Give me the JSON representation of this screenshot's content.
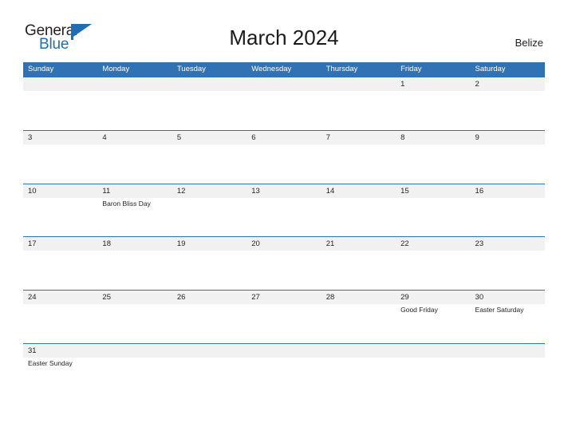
{
  "brand": {
    "name_part1": "General",
    "name_part2": "Blue",
    "flag_icon": "blue-triangle-flag",
    "colors": {
      "dark_text": "#231f20",
      "blue": "#1f6db5"
    }
  },
  "header": {
    "title": "March 2024",
    "region": "Belize"
  },
  "theme": {
    "header_blue": "#3172b5",
    "band_gray": "#f1f1f1",
    "rule_blue": "#3172b5",
    "text": "#231f20",
    "header_text": "#ffffff"
  },
  "calendar": {
    "month": "March",
    "year": "2024",
    "weekday_headers": [
      "Sunday",
      "Monday",
      "Tuesday",
      "Wednesday",
      "Thursday",
      "Friday",
      "Saturday"
    ],
    "weeks": [
      {
        "days": [
          {
            "number": "",
            "event": ""
          },
          {
            "number": "",
            "event": ""
          },
          {
            "number": "",
            "event": ""
          },
          {
            "number": "",
            "event": ""
          },
          {
            "number": "",
            "event": ""
          },
          {
            "number": "1",
            "event": ""
          },
          {
            "number": "2",
            "event": ""
          }
        ]
      },
      {
        "days": [
          {
            "number": "3",
            "event": ""
          },
          {
            "number": "4",
            "event": ""
          },
          {
            "number": "5",
            "event": ""
          },
          {
            "number": "6",
            "event": ""
          },
          {
            "number": "7",
            "event": ""
          },
          {
            "number": "8",
            "event": ""
          },
          {
            "number": "9",
            "event": ""
          }
        ]
      },
      {
        "days": [
          {
            "number": "10",
            "event": ""
          },
          {
            "number": "11",
            "event": "Baron Bliss Day"
          },
          {
            "number": "12",
            "event": ""
          },
          {
            "number": "13",
            "event": ""
          },
          {
            "number": "14",
            "event": ""
          },
          {
            "number": "15",
            "event": ""
          },
          {
            "number": "16",
            "event": ""
          }
        ]
      },
      {
        "days": [
          {
            "number": "17",
            "event": ""
          },
          {
            "number": "18",
            "event": ""
          },
          {
            "number": "19",
            "event": ""
          },
          {
            "number": "20",
            "event": ""
          },
          {
            "number": "21",
            "event": ""
          },
          {
            "number": "22",
            "event": ""
          },
          {
            "number": "23",
            "event": ""
          }
        ]
      },
      {
        "days": [
          {
            "number": "24",
            "event": ""
          },
          {
            "number": "25",
            "event": ""
          },
          {
            "number": "26",
            "event": ""
          },
          {
            "number": "27",
            "event": ""
          },
          {
            "number": "28",
            "event": ""
          },
          {
            "number": "29",
            "event": "Good Friday"
          },
          {
            "number": "30",
            "event": "Easter Saturday"
          }
        ]
      },
      {
        "days": [
          {
            "number": "31",
            "event": "Easter Sunday"
          },
          {
            "number": "",
            "event": ""
          },
          {
            "number": "",
            "event": ""
          },
          {
            "number": "",
            "event": ""
          },
          {
            "number": "",
            "event": ""
          },
          {
            "number": "",
            "event": ""
          },
          {
            "number": "",
            "event": ""
          }
        ]
      }
    ]
  }
}
